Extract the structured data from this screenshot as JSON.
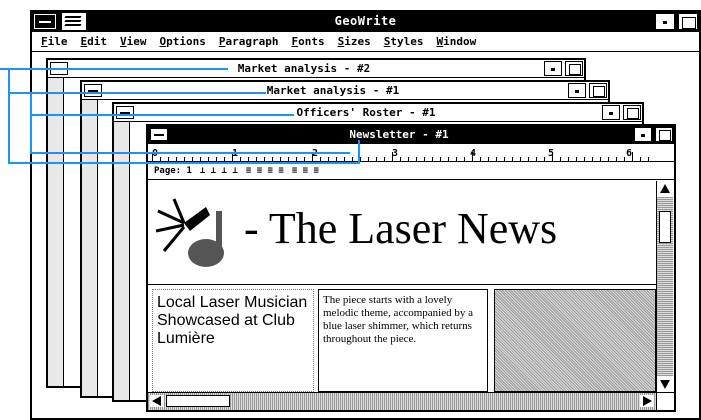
{
  "app": {
    "title": "GeoWrite",
    "menu": [
      "File",
      "Edit",
      "View",
      "Options",
      "Paragraph",
      "Fonts",
      "Sizes",
      "Styles",
      "Window"
    ]
  },
  "windows": [
    {
      "title": "Market analysis - #2",
      "active": false
    },
    {
      "title": "Market analysis - #1",
      "active": false
    },
    {
      "title": "Officers' Roster - #1",
      "active": false
    },
    {
      "title": "Newsletter - #1",
      "active": true
    }
  ],
  "ruler": {
    "numbers": [
      "0",
      "1",
      "2",
      "3",
      "4",
      "5",
      "6"
    ],
    "page_label": "Page: 1"
  },
  "document": {
    "headline": "- The Laser News",
    "story_heading": "Local Laser Musician Showcased at Club Lumière",
    "story_text": "The piece starts with a lovely melodic theme, accompanied by a blue laser shimmer, which returns throughout the piece."
  },
  "colors": {
    "connector": "#1e90ff",
    "active_titlebar": "#000000"
  }
}
